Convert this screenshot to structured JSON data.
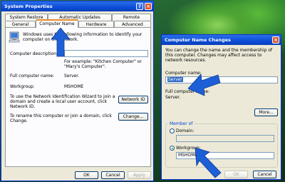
{
  "sysprops": {
    "title": "System Properties",
    "tabs_row1": [
      "System Restore",
      "Automatic Updates",
      "Remote"
    ],
    "tabs_row2": [
      "General",
      "Computer Name",
      "Hardware",
      "Advanced"
    ],
    "intro": "Windows uses the following information to identify your computer on the network.",
    "desc_label": "Computer description:",
    "desc_value": "",
    "example": "For example: \"Kitchen Computer\" or \"Mary's Computer\".",
    "fullname_label": "Full computer name:",
    "fullname_value": "Server.",
    "workgroup_label": "Workgroup:",
    "workgroup_value": "MSHOME",
    "wizard_text": "To use the Network Identification Wizard to join a domain and create a local user account, click Network ID.",
    "network_id_button": "Network ID",
    "rename_text": "To rename this computer or join a domain, click Change.",
    "change_button": "Change...",
    "ok_button": "OK",
    "cancel_button": "Cancel",
    "apply_button": "Apply"
  },
  "namechange": {
    "title": "Computer Name Changes",
    "intro": "You can change the name and the membership of this computer. Changes may affect access to network resources.",
    "name_label": "Computer name:",
    "name_value": "Server",
    "fullname_label": "Full computer name:",
    "fullname_value": "Server.",
    "more_button": "More...",
    "member_of_label": "Member of",
    "domain_label": "Domain:",
    "domain_value": "",
    "workgroup_label": "Workgroup:",
    "workgroup_value": "MSHOME",
    "ok_button": "OK",
    "cancel_button": "Cancel"
  },
  "colors": {
    "arrow": "#1d5fd6",
    "titlebar": "#0b4dd8",
    "dialog_bg": "#ece9d8",
    "tab_accent": "#e68b2c"
  }
}
